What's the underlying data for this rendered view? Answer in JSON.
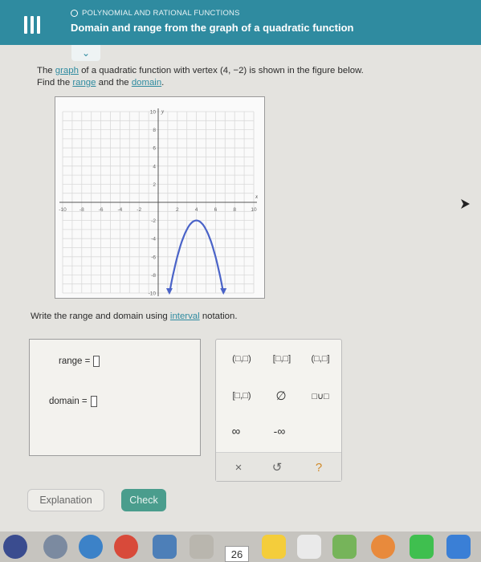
{
  "header": {
    "topic": "POLYNOMIAL AND RATIONAL FUNCTIONS",
    "title": "Domain and range from the graph of a quadratic function"
  },
  "prompt": {
    "line1_a": "The ",
    "line1_link": "graph",
    "line1_b": " of a quadratic function with vertex ",
    "vertex": "(4, −2)",
    "line1_c": " is shown in the figure below.",
    "line2_a": "Find the ",
    "link_range": "range",
    "line2_b": " and the ",
    "link_domain": "domain",
    "line2_c": "."
  },
  "graph": {
    "x_axis_label": "x",
    "y_axis_label": "y",
    "x_ticks": [
      "-10",
      "-8",
      "-6",
      "-4",
      "-2",
      "2",
      "4",
      "6",
      "8",
      "10"
    ],
    "y_ticks": [
      "10",
      "8",
      "6",
      "4",
      "2",
      "-2",
      "-4",
      "-6",
      "-8",
      "-10"
    ],
    "xlim": [
      -10,
      10
    ],
    "ylim": [
      -10,
      10
    ],
    "grid": true,
    "curve": {
      "vertex_x": 4,
      "vertex_y": -2,
      "a": -1,
      "endpoints_y": -10,
      "arrows": true,
      "color": "#4a63c8"
    }
  },
  "instruction": {
    "a": "Write the range and domain using ",
    "link": "interval",
    "b": " notation."
  },
  "answers": {
    "range_label": "range =",
    "domain_label": "domain ="
  },
  "keypad": {
    "open_open": "(□,□)",
    "closed_closed": "[□,□]",
    "open_closed": "(□,□]",
    "closed_open": "[□,□)",
    "empty_set": "∅",
    "union": "□∪□",
    "infinity": "∞",
    "neg_infinity": "-∞",
    "clear": "×",
    "undo": "↺",
    "help": "?"
  },
  "buttons": {
    "explanation": "Explanation",
    "check": "Check"
  },
  "dock": {
    "calendar_day": "26"
  },
  "colors": {
    "header": "#2f8ba0",
    "check_button": "#4a9d8d",
    "curve": "#4a63c8"
  }
}
